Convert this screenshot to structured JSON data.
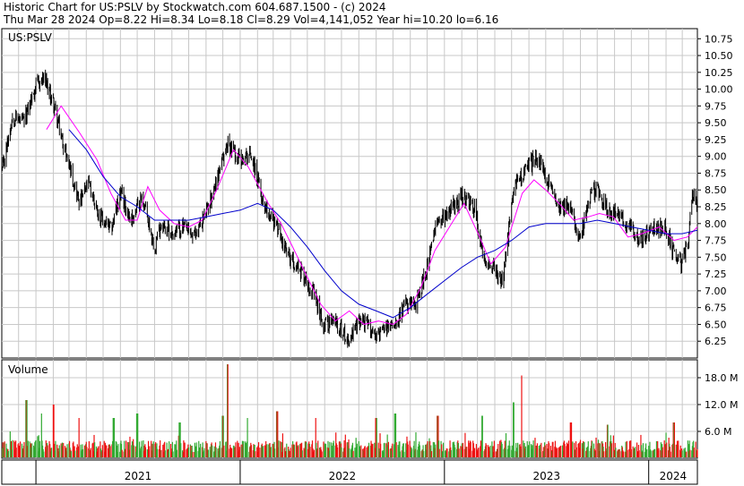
{
  "header": {
    "line1": "Historic Chart for US:PSLV by Stockwatch.com 604.687.1500 - (c) 2024",
    "line2": "Thu Mar 28 2024  Op=8.22  Hi=8.34  Lo=8.18  Cl=8.29  Vol=4,141,052  Year hi=10.20  lo=6.16"
  },
  "colors": {
    "price": "#000000",
    "ma_short": "#ff00ff",
    "ma_long": "#0000cc",
    "vol_up": "#33aa33",
    "vol_down": "#ee1111",
    "grid": "#c8c8c8"
  },
  "chart_data": [
    {
      "type": "line",
      "panel_label": "US:PSLV",
      "ylim": [
        6.0,
        10.9
      ],
      "y_ticks": [
        "6.25",
        "6.50",
        "6.75",
        "7.00",
        "7.25",
        "7.50",
        "7.75",
        "8.00",
        "8.25",
        "8.50",
        "8.75",
        "9.00",
        "9.25",
        "9.50",
        "9.75",
        "10.00",
        "10.25",
        "10.50",
        "10.75"
      ],
      "x_labels": [
        "2021",
        "2022",
        "2023",
        "2024"
      ],
      "x_label_dates": [
        "2021-01-01",
        "2022-01-01",
        "2023-01-01",
        "2024-01-01"
      ],
      "x_range": [
        "2020-11-01",
        "2024-03-28"
      ],
      "grid": true,
      "series": [
        {
          "name": "",
          "role": "price",
          "x": [
            "2020-11-01",
            "2020-11-20",
            "2020-12-10",
            "2021-01-01",
            "2021-01-15",
            "2021-02-01",
            "2021-02-15",
            "2021-03-01",
            "2021-03-20",
            "2021-04-05",
            "2021-04-25",
            "2021-05-15",
            "2021-06-01",
            "2021-06-20",
            "2021-07-10",
            "2021-08-01",
            "2021-08-12",
            "2021-09-01",
            "2021-09-20",
            "2021-10-10",
            "2021-11-01",
            "2021-11-16",
            "2021-12-10",
            "2022-01-01",
            "2022-01-20",
            "2022-02-10",
            "2022-03-08",
            "2022-03-25",
            "2022-04-20",
            "2022-05-10",
            "2022-05-30",
            "2022-06-20",
            "2022-07-15",
            "2022-08-05",
            "2022-08-20",
            "2022-09-01",
            "2022-09-15",
            "2022-10-05",
            "2022-10-25",
            "2022-11-10",
            "2022-12-01",
            "2022-12-20",
            "2023-01-10",
            "2023-02-01",
            "2023-02-25",
            "2023-03-10",
            "2023-03-30",
            "2023-04-15",
            "2023-05-05",
            "2023-05-25",
            "2023-06-15",
            "2023-07-10",
            "2023-07-25",
            "2023-08-15",
            "2023-09-01",
            "2023-09-20",
            "2023-10-03",
            "2023-10-20",
            "2023-11-10",
            "2023-12-01",
            "2023-12-20",
            "2024-01-15",
            "2024-02-01",
            "2024-02-15",
            "2024-02-28",
            "2024-03-10",
            "2024-03-20",
            "2024-03-28"
          ],
          "values": [
            8.75,
            9.6,
            9.5,
            10.05,
            10.15,
            9.8,
            9.3,
            8.9,
            8.3,
            8.6,
            8.1,
            7.9,
            8.45,
            8.05,
            8.4,
            7.65,
            8.0,
            7.85,
            7.95,
            7.8,
            8.15,
            8.55,
            9.2,
            8.95,
            9.05,
            8.35,
            7.95,
            7.55,
            7.3,
            7.0,
            6.5,
            6.55,
            6.25,
            6.6,
            6.45,
            6.35,
            6.4,
            6.55,
            6.8,
            6.75,
            7.35,
            8.05,
            8.2,
            8.4,
            8.2,
            7.55,
            7.35,
            7.1,
            8.55,
            8.8,
            9.0,
            8.5,
            8.3,
            8.2,
            7.8,
            8.45,
            8.5,
            8.2,
            8.1,
            7.9,
            7.75,
            7.95,
            7.9,
            7.55,
            7.4,
            7.65,
            8.45,
            8.29
          ]
        },
        {
          "name": "",
          "role": "short moving average",
          "x": [
            "2021-01-20",
            "2021-02-15",
            "2021-03-20",
            "2021-04-20",
            "2021-05-15",
            "2021-06-10",
            "2021-07-01",
            "2021-07-20",
            "2021-08-10",
            "2021-09-05",
            "2021-10-01",
            "2021-10-25",
            "2021-11-20",
            "2021-12-20",
            "2022-01-15",
            "2022-02-20",
            "2022-03-15",
            "2022-04-05",
            "2022-05-01",
            "2022-05-25",
            "2022-06-20",
            "2022-07-15",
            "2022-08-10",
            "2022-09-05",
            "2022-10-01",
            "2022-10-25",
            "2022-11-20",
            "2022-12-15",
            "2023-01-10",
            "2023-02-05",
            "2023-03-05",
            "2023-03-25",
            "2023-04-20",
            "2023-05-20",
            "2023-06-10",
            "2023-07-01",
            "2023-07-25",
            "2023-08-20",
            "2023-09-15",
            "2023-10-05",
            "2023-10-30",
            "2023-11-25",
            "2023-12-20",
            "2024-01-20",
            "2024-02-15",
            "2024-03-10",
            "2024-03-28"
          ],
          "values": [
            9.4,
            9.75,
            9.35,
            8.95,
            8.45,
            8.05,
            8.05,
            8.55,
            8.2,
            8.0,
            7.95,
            8.05,
            8.5,
            9.1,
            8.85,
            8.3,
            8.0,
            7.65,
            7.2,
            6.8,
            6.55,
            6.7,
            6.5,
            6.55,
            6.5,
            6.65,
            7.05,
            7.6,
            7.95,
            8.3,
            7.8,
            7.4,
            7.65,
            8.45,
            8.65,
            8.5,
            8.3,
            8.05,
            8.1,
            8.15,
            8.1,
            7.8,
            7.85,
            7.95,
            7.75,
            7.8,
            7.95
          ]
        },
        {
          "name": "",
          "role": "long moving average",
          "x": [
            "2021-03-01",
            "2021-04-01",
            "2021-05-01",
            "2021-06-01",
            "2021-07-01",
            "2021-08-01",
            "2021-09-01",
            "2021-10-01",
            "2021-11-01",
            "2021-12-01",
            "2022-01-01",
            "2022-02-01",
            "2022-03-01",
            "2022-04-01",
            "2022-05-01",
            "2022-06-01",
            "2022-07-01",
            "2022-08-01",
            "2022-09-01",
            "2022-10-01",
            "2022-11-01",
            "2022-12-01",
            "2023-01-01",
            "2023-02-01",
            "2023-03-01",
            "2023-04-01",
            "2023-05-01",
            "2023-06-01",
            "2023-07-01",
            "2023-08-01",
            "2023-09-01",
            "2023-10-01",
            "2023-11-01",
            "2023-12-01",
            "2024-01-01",
            "2024-02-01",
            "2024-03-01",
            "2024-03-28"
          ],
          "values": [
            9.4,
            9.1,
            8.7,
            8.4,
            8.25,
            8.05,
            8.05,
            8.05,
            8.1,
            8.15,
            8.2,
            8.3,
            8.2,
            7.95,
            7.65,
            7.3,
            7.0,
            6.8,
            6.7,
            6.6,
            6.75,
            6.95,
            7.15,
            7.35,
            7.5,
            7.6,
            7.75,
            7.95,
            8.0,
            8.0,
            8.0,
            8.05,
            8.0,
            7.95,
            7.9,
            7.85,
            7.85,
            7.9
          ]
        }
      ]
    },
    {
      "type": "bar",
      "panel_label": "Volume",
      "unit": "M",
      "ylim": [
        0,
        22.0
      ],
      "y_ticks": [
        "6.0 M",
        "12.0 M",
        "18.0 M"
      ],
      "x_range": [
        "2020-11-01",
        "2024-03-28"
      ],
      "spikes": [
        {
          "x": "2020-11-15",
          "value": 6.0
        },
        {
          "x": "2020-12-15",
          "value": 13.0
        },
        {
          "x": "2021-01-10",
          "value": 10.0
        },
        {
          "x": "2021-02-01",
          "value": 12.0
        },
        {
          "x": "2021-03-20",
          "value": 9.0
        },
        {
          "x": "2021-05-20",
          "value": 9.0
        },
        {
          "x": "2021-07-01",
          "value": 10.0
        },
        {
          "x": "2021-09-15",
          "value": 8.0
        },
        {
          "x": "2021-12-01",
          "value": 9.5
        },
        {
          "x": "2021-12-10",
          "value": 21.0
        },
        {
          "x": "2022-01-15",
          "value": 9.0
        },
        {
          "x": "2022-03-08",
          "value": 10.5
        },
        {
          "x": "2022-05-15",
          "value": 9.0
        },
        {
          "x": "2022-09-01",
          "value": 9.0
        },
        {
          "x": "2022-10-05",
          "value": 10.0
        },
        {
          "x": "2022-12-20",
          "value": 9.5
        },
        {
          "x": "2023-03-10",
          "value": 9.5
        },
        {
          "x": "2023-05-05",
          "value": 12.5
        },
        {
          "x": "2023-05-20",
          "value": 18.5
        },
        {
          "x": "2023-08-15",
          "value": 8.0
        },
        {
          "x": "2023-10-20",
          "value": 7.5
        },
        {
          "x": "2024-02-15",
          "value": 8.0
        }
      ]
    }
  ]
}
